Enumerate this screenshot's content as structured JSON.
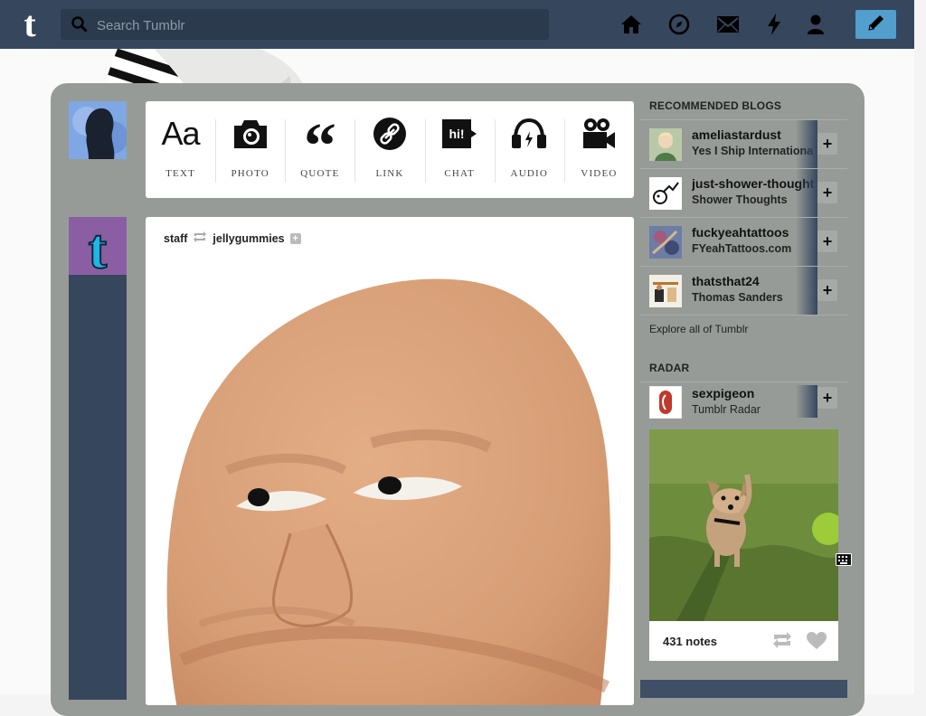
{
  "header": {
    "search_placeholder": "Search Tumblr",
    "nav": [
      "home-icon",
      "explore-icon",
      "inbox-icon",
      "activity-icon",
      "account-icon"
    ],
    "accent": "#529ecc",
    "bar_color": "#36465d"
  },
  "post_types": [
    {
      "label": "TEXT",
      "icon": "text-icon"
    },
    {
      "label": "PHOTO",
      "icon": "camera-icon"
    },
    {
      "label": "QUOTE",
      "icon": "quote-icon"
    },
    {
      "label": "LINK",
      "icon": "link-icon"
    },
    {
      "label": "CHAT",
      "icon": "chat-icon"
    },
    {
      "label": "AUDIO",
      "icon": "headphones-icon"
    },
    {
      "label": "VIDEO",
      "icon": "video-camera-icon"
    }
  ],
  "post": {
    "author": "staff",
    "reblogged_from": "jellygummies"
  },
  "sidebar": {
    "recommended_title": "RECOMMENDED BLOGS",
    "blogs": [
      {
        "name": "ameliastardust",
        "subtitle": "Yes I Ship International"
      },
      {
        "name": "just-shower-thoughts",
        "subtitle": "Shower Thoughts"
      },
      {
        "name": "fuckyeahtattoos",
        "subtitle": "FYeahTattoos.com"
      },
      {
        "name": "thatsthat24",
        "subtitle": "Thomas Sanders"
      }
    ],
    "explore_link": "Explore all of Tumblr",
    "radar_title": "RADAR",
    "radar": {
      "name": "sexpigeon",
      "subtitle": "Tumblr Radar",
      "notes": "431 notes"
    }
  }
}
